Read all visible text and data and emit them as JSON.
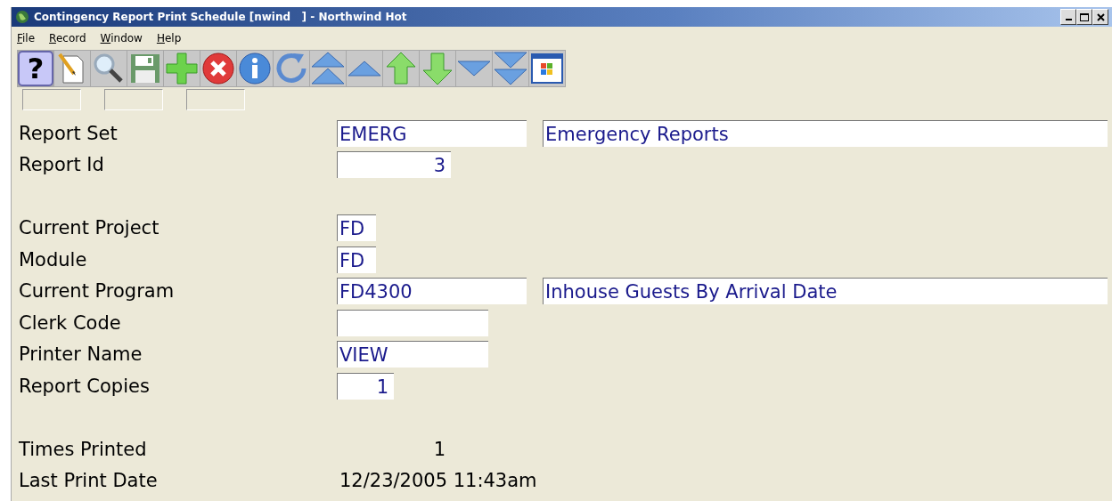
{
  "window": {
    "title": "Contingency Report Print Schedule [nwind   ] - Northwind Hot"
  },
  "menu": [
    {
      "label": "File"
    },
    {
      "label": "Record"
    },
    {
      "label": "Window"
    },
    {
      "label": "Help"
    }
  ],
  "toolbar": [
    {
      "kind": "help",
      "label": "?"
    },
    {
      "kind": "new"
    },
    {
      "kind": "search"
    },
    {
      "kind": "save"
    },
    {
      "kind": "add"
    },
    {
      "kind": "delete"
    },
    {
      "kind": "info"
    },
    {
      "kind": "refresh"
    },
    {
      "kind": "first"
    },
    {
      "kind": "prev-page"
    },
    {
      "kind": "prev"
    },
    {
      "kind": "next"
    },
    {
      "kind": "next-page"
    },
    {
      "kind": "last"
    },
    {
      "kind": "window"
    }
  ],
  "sections": [
    [
      {
        "label": "Report Set",
        "fields": [
          {
            "kind": "code",
            "value": "EMERG"
          },
          {
            "kind": "wide",
            "value": "Emergency Reports"
          }
        ]
      },
      {
        "label": "Report Id",
        "fields": [
          {
            "kind": "id",
            "value": "3"
          }
        ]
      }
    ],
    [
      {
        "label": "Current Project",
        "fields": [
          {
            "kind": "tiny",
            "value": "FD"
          }
        ]
      },
      {
        "label": "Module",
        "fields": [
          {
            "kind": "tiny",
            "value": "FD"
          }
        ]
      },
      {
        "label": "Current Program",
        "fields": [
          {
            "kind": "code",
            "value": "FD4300"
          },
          {
            "kind": "wide",
            "value": "Inhouse Guests By Arrival Date"
          }
        ]
      },
      {
        "label": "Clerk Code",
        "fields": [
          {
            "kind": "medium"
          }
        ]
      },
      {
        "label": "Printer Name",
        "fields": [
          {
            "kind": "medium",
            "value": "VIEW"
          }
        ]
      },
      {
        "label": "Report Copies",
        "fields": [
          {
            "kind": "count",
            "value": "1"
          }
        ]
      }
    ],
    [
      {
        "label": "Times Printed",
        "fields": [
          {
            "kind": "display-num",
            "value": "1"
          }
        ]
      },
      {
        "label": "Last Print Date",
        "fields": [
          {
            "kind": "display",
            "value": "12/23/2005 11:43am"
          }
        ]
      }
    ]
  ]
}
